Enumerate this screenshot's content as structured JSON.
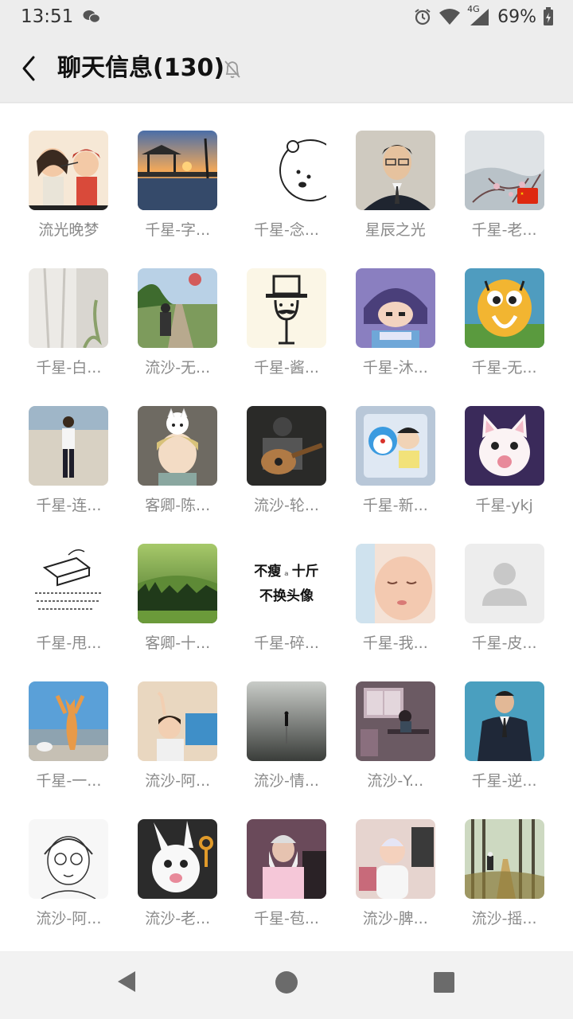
{
  "status_bar": {
    "time": "13:51",
    "battery": "69%",
    "network": "4G"
  },
  "header": {
    "title": "聊天信息(130)"
  },
  "members": [
    {
      "name": "流光晚梦",
      "avatar": "cartoon-couple-avatar"
    },
    {
      "name": "千星-字...",
      "avatar": "sunset-pier-avatar"
    },
    {
      "name": "千星-念...",
      "avatar": "white-bear-avatar"
    },
    {
      "name": "星辰之光",
      "avatar": "man-portrait-avatar"
    },
    {
      "name": "千星-老...",
      "avatar": "snow-branch-avatar"
    },
    {
      "name": "千星-白...",
      "avatar": "white-wall-avatar"
    },
    {
      "name": "流沙-无...",
      "avatar": "path-walker-avatar"
    },
    {
      "name": "千星-酱...",
      "avatar": "mustache-hat-avatar"
    },
    {
      "name": "千星-沐...",
      "avatar": "anime-boy-avatar"
    },
    {
      "name": "千星-无...",
      "avatar": "cartoon-creature-avatar"
    },
    {
      "name": "千星-连...",
      "avatar": "standing-man-avatar"
    },
    {
      "name": "客卿-陈...",
      "avatar": "anime-cat-avatar"
    },
    {
      "name": "流沙-轮...",
      "avatar": "guitar-avatar"
    },
    {
      "name": "千星-新...",
      "avatar": "doraemon-avatar"
    },
    {
      "name": "千星-ykj",
      "avatar": "white-kitten-avatar"
    },
    {
      "name": "千星-甩...",
      "avatar": "sketch-text-avatar"
    },
    {
      "name": "客卿-十...",
      "avatar": "green-hills-avatar"
    },
    {
      "name": "千星-碎...",
      "avatar": "text-slogan-avatar",
      "slogan_line1": "不瘦",
      "slogan_mark": "a",
      "slogan_line1b": "十斤",
      "slogan_line2": "不换头像"
    },
    {
      "name": "千星-我...",
      "avatar": "sleeping-baby-avatar"
    },
    {
      "name": "千星-皮...",
      "avatar": "default-person-avatar"
    },
    {
      "name": "千星-一...",
      "avatar": "standing-cat-avatar"
    },
    {
      "name": "流沙-阿...",
      "avatar": "child-playing-avatar"
    },
    {
      "name": "流沙-情...",
      "avatar": "foggy-beach-avatar"
    },
    {
      "name": "流沙-Y...",
      "avatar": "illustrated-room-avatar"
    },
    {
      "name": "千星-逆...",
      "avatar": "suit-man-avatar"
    },
    {
      "name": "流沙-阿...",
      "avatar": "sketch-girl-avatar"
    },
    {
      "name": "流沙-老...",
      "avatar": "white-rabbit-avatar"
    },
    {
      "name": "千星-苞...",
      "avatar": "wizard-avatar"
    },
    {
      "name": "流沙-脾...",
      "avatar": "toddler-avatar"
    },
    {
      "name": "流沙-摇...",
      "avatar": "forest-path-avatar"
    }
  ],
  "colors": {
    "header_bg": "#ededed",
    "grid_bg": "#ffffff",
    "name_text": "#8a8a8a"
  }
}
